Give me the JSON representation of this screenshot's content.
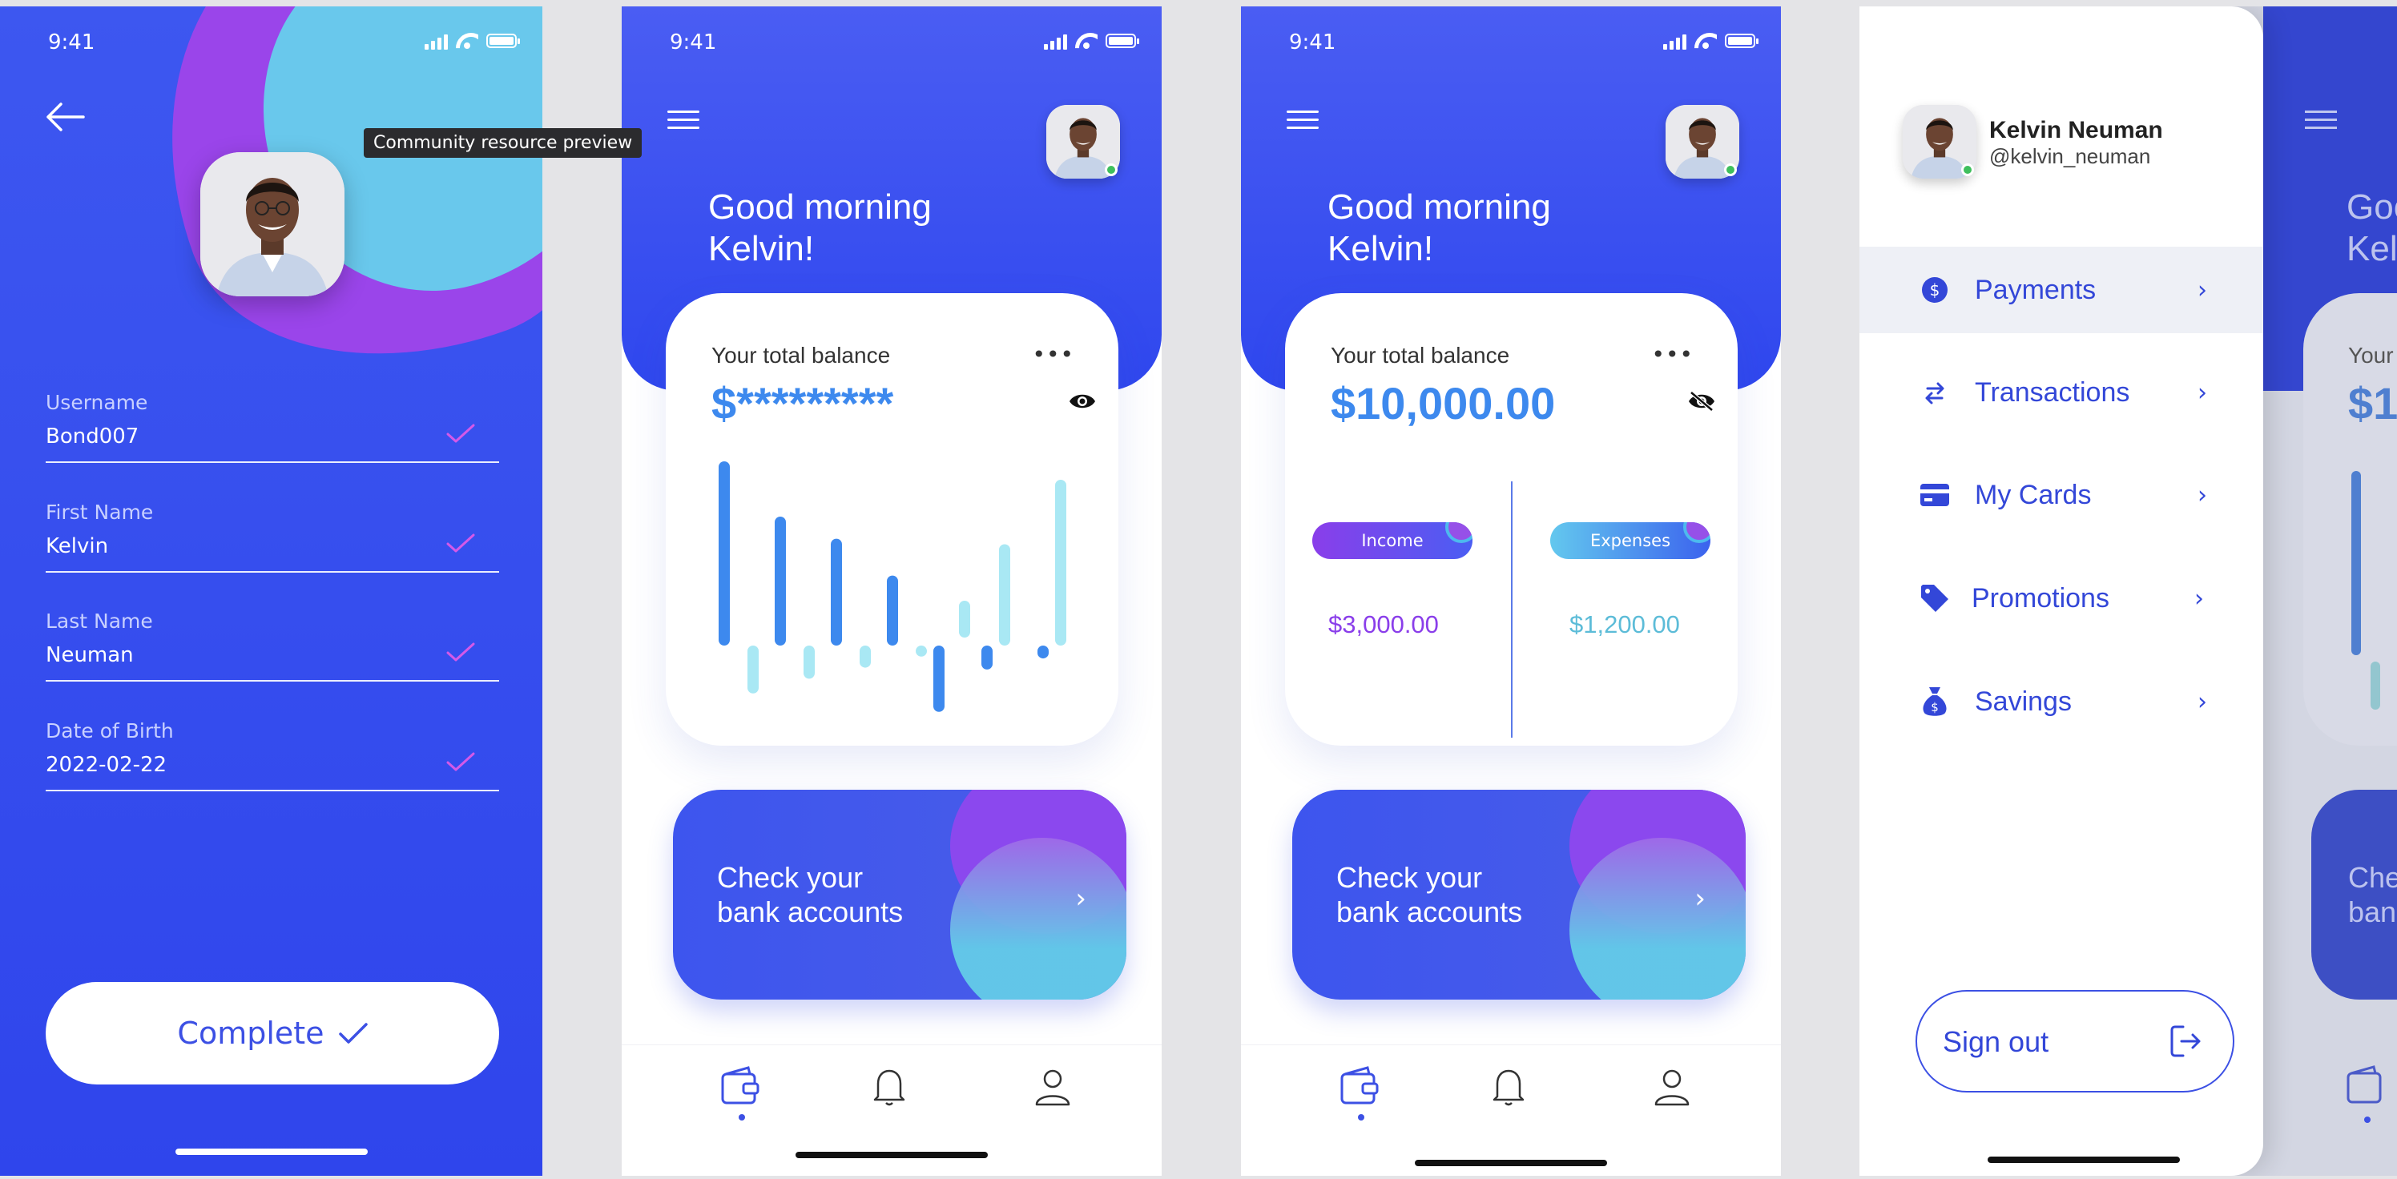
{
  "status": {
    "time": "9:41"
  },
  "profile": {
    "tooltip": "Community resource preview",
    "fields": [
      {
        "label": "Username",
        "value": "Bond007"
      },
      {
        "label": "First Name",
        "value": "Kelvin"
      },
      {
        "label": "Last Name",
        "value": "Neuman"
      },
      {
        "label": "Date of Birth",
        "value": "2022-02-22"
      }
    ],
    "complete_label": "Complete"
  },
  "home": {
    "greeting_line1": "Good morning",
    "greeting_line2": "Kelvin!",
    "balance_title": "Your total balance",
    "balance_hidden": "$*********",
    "balance_shown": "$10,000.00",
    "more_label": "•••",
    "check_line1": "Check your",
    "check_line2": "bank accounts",
    "income_label": "Income",
    "income_value": "$3,000.00",
    "expenses_label": "Expenses",
    "expenses_value": "$1,200.00"
  },
  "chart_data": {
    "type": "bar",
    "categories": [
      "1",
      "2",
      "3",
      "4",
      "5",
      "6",
      "7"
    ],
    "series": [
      {
        "values": [
          1.0,
          0.7,
          0.58,
          0.38,
          0.2,
          0.55,
          0.9
        ]
      },
      {
        "values": [
          -0.26,
          -0.18,
          -0.12,
          -0.06,
          -0.36,
          -0.13,
          -0.07
        ]
      }
    ]
  },
  "drawer": {
    "name": "Kelvin Neuman",
    "handle": "@kelvin_neuman",
    "items": [
      {
        "label": "Payments",
        "icon": "dollar-circle-icon"
      },
      {
        "label": "Transactions",
        "icon": "swap-arrows-icon"
      },
      {
        "label": "My Cards",
        "icon": "credit-card-icon"
      },
      {
        "label": "Promotions",
        "icon": "tag-icon"
      },
      {
        "label": "Savings",
        "icon": "money-bag-icon"
      }
    ],
    "signout_label": "Sign out",
    "peek_greeting1": "Goo",
    "peek_greeting2": "Kelv",
    "peek_balance_title": "Your t",
    "peek_balance": "$10",
    "peek_check1": "Che",
    "peek_check2": "ban"
  },
  "colors": {
    "primary": "#3c50e4",
    "income": "#8a3eea",
    "expenses": "#5cbcd8",
    "bar_dark": "#3d89ee",
    "bar_light": "#a9e8f4"
  }
}
